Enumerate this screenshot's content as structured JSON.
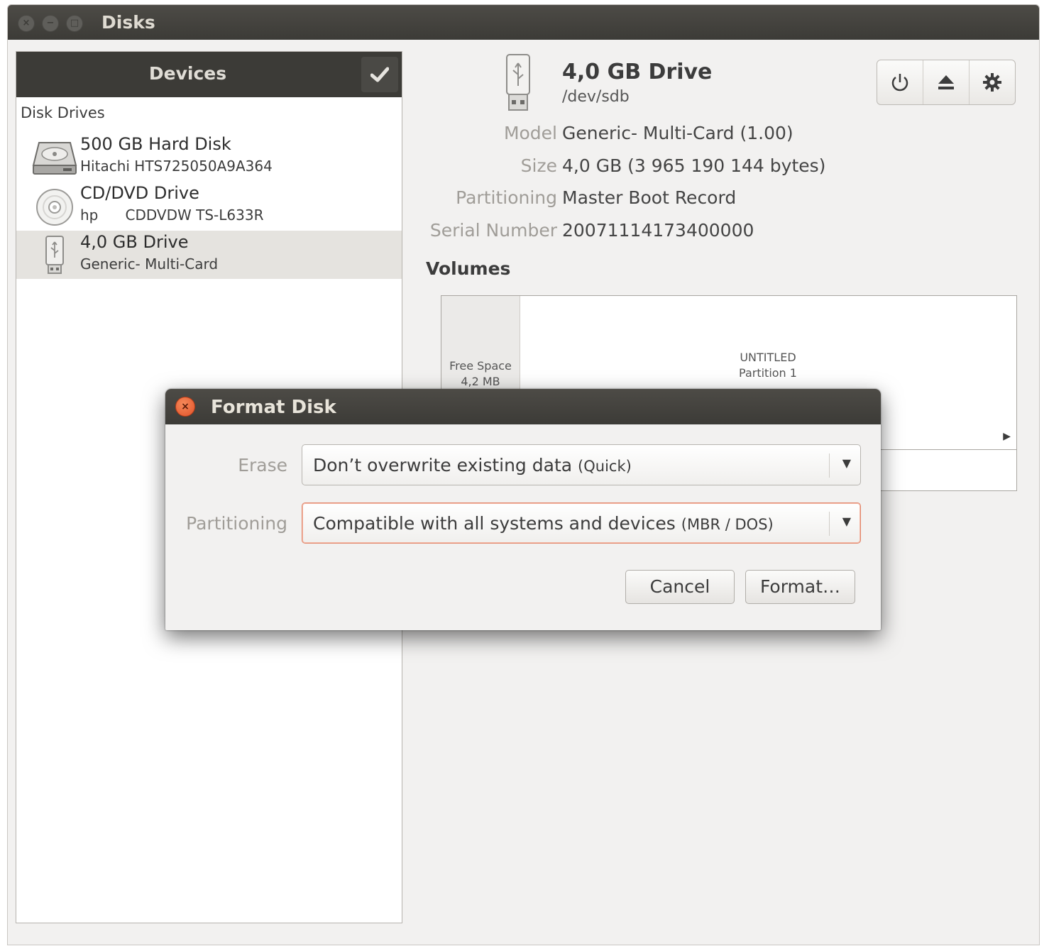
{
  "window": {
    "title": "Disks"
  },
  "sidebar": {
    "header": "Devices",
    "section_label": "Disk Drives",
    "drives": [
      {
        "name": "500 GB Hard Disk",
        "sub": "Hitachi HTS725050A9A364",
        "icon": "hard-disk-icon"
      },
      {
        "name": "CD/DVD Drive",
        "sub": "hp      CDDVDW TS-L633R",
        "icon": "optical-disc-icon"
      },
      {
        "name": "4,0 GB Drive",
        "sub": "Generic- Multi-Card",
        "icon": "usb-drive-icon",
        "selected": true
      }
    ]
  },
  "drive": {
    "title": "4,0 GB Drive",
    "path": "/dev/sdb",
    "properties": [
      {
        "label": "Model",
        "value": "Generic- Multi-Card (1.00)"
      },
      {
        "label": "Size",
        "value": "4,0 GB (3 965 190 144 bytes)"
      },
      {
        "label": "Partitioning",
        "value": "Master Boot Record"
      },
      {
        "label": "Serial Number",
        "value": "20071114173400000"
      }
    ],
    "toolbar": [
      "power-icon",
      "eject-icon",
      "gear-icon"
    ]
  },
  "volumes": {
    "title": "Volumes",
    "free_space": {
      "label": "Free Space",
      "size": "4,2 MB"
    },
    "partition": {
      "name": "UNTITLED",
      "label": "Partition 1"
    }
  },
  "dialog": {
    "title": "Format Disk",
    "erase": {
      "label": "Erase",
      "value": "Don’t overwrite existing data",
      "hint": "(Quick)"
    },
    "partitioning": {
      "label": "Partitioning",
      "value": "Compatible with all systems and devices",
      "hint": "(MBR / DOS)"
    },
    "cancel_label": "Cancel",
    "format_label": "Format…"
  },
  "colors": {
    "titlebar": "#3c3b37",
    "accent": "#e2876c",
    "close": "#e1522a"
  }
}
